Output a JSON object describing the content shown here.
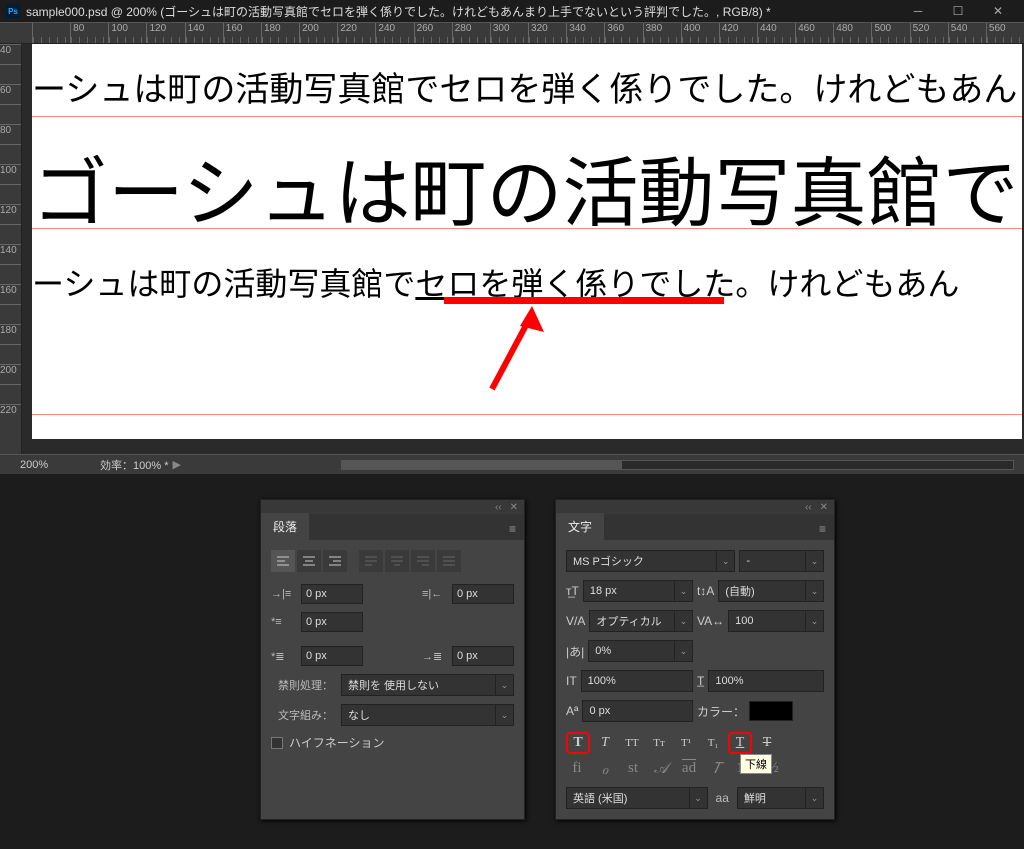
{
  "titlebar": {
    "app": "Ps",
    "filename": "sample000.psd @ 200% (ゴーシュは町の活動写真館でセロを弾く係りでした。けれどもあんまり上手でないという評判でした。, RGB/8) *"
  },
  "ruler_h": [
    "",
    "80",
    "100",
    "120",
    "140",
    "160",
    "180",
    "200",
    "220",
    "240",
    "260",
    "280",
    "300",
    "320",
    "340",
    "360",
    "380",
    "400",
    "420",
    "440",
    "460",
    "480",
    "500",
    "520",
    "540",
    "560"
  ],
  "ruler_v": [
    "40",
    "",
    "60",
    "",
    "80",
    "",
    "100",
    "",
    "120",
    "",
    "140",
    "",
    "160",
    "",
    "180",
    "",
    "200",
    "",
    "220"
  ],
  "canvas": {
    "line1": "ーシュは町の活動写真館でセロを弾く係りでした。けれどもあん",
    "line2": "ゴーシュは町の活動写真館でセ",
    "line3_pre": "ーシュは町の活動写真館で",
    "line3_ul": "セロを弾く係り",
    "line3_post": "でした。けれどもあん"
  },
  "status": {
    "zoom": "200%",
    "efficiency": "効率：100% *"
  },
  "paragraph_panel": {
    "tab": "段落",
    "indent_left": "0 px",
    "indent_right": "0 px",
    "first_line": "0 px",
    "space_before": "0 px",
    "space_after": "0 px",
    "kinsoku_label": "禁則処理：",
    "kinsoku_value": "禁則を 使用しない",
    "mojikumi_label": "文字組み：",
    "mojikumi_value": "なし",
    "hyphenation": "ハイフネーション"
  },
  "character_panel": {
    "tab": "文字",
    "font_family": "MS Pゴシック",
    "font_style": "-",
    "font_size": "18 px",
    "leading": "(自動)",
    "kerning": "オプティカル",
    "tracking": "100",
    "tsume": "0%",
    "vscale": "100%",
    "hscale": "100%",
    "baseline": "0 px",
    "color_label": "カラー：",
    "tooltip": "下線",
    "language": "英語 (米国)",
    "aa_label": "aa",
    "antialias": "鮮明"
  }
}
